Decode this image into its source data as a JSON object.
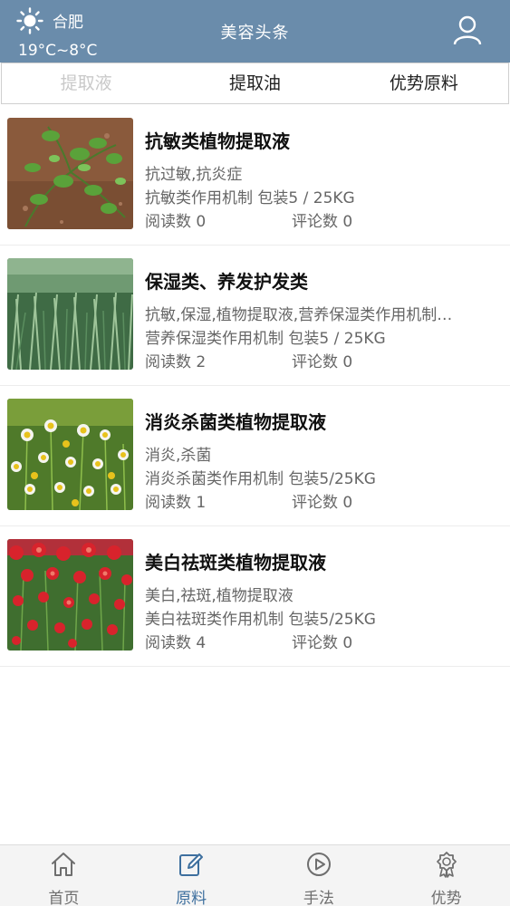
{
  "header": {
    "city": "合肥",
    "temperature": "19°C~8°C",
    "title": "美容头条",
    "weather_icon": "sun-icon",
    "user_icon": "user-icon",
    "bg_color": "#6a8cab"
  },
  "tabs": [
    {
      "label": "提取液",
      "active": true
    },
    {
      "label": "提取油",
      "active": false
    },
    {
      "label": "优势原料",
      "active": false
    }
  ],
  "items": [
    {
      "title": "抗敏类植物提取液",
      "desc": "抗过敏,抗炎症",
      "meta": "抗敏类作用机制  包装5 / 25KG",
      "reads": "阅读数 0",
      "comments": "评论数 0"
    },
    {
      "title": "保湿类、养发护发类",
      "desc": "抗敏,保湿,植物提取液,营养保湿类作用机制…",
      "meta": "营养保湿类作用机制 包装5 / 25KG",
      "reads": "阅读数 2",
      "comments": "评论数 0"
    },
    {
      "title": "消炎杀菌类植物提取液",
      "desc": "消炎,杀菌",
      "meta": "消炎杀菌类作用机制  包装5/25KG",
      "reads": "阅读数 1",
      "comments": "评论数 0"
    },
    {
      "title": "美白祛斑类植物提取液",
      "desc": "美白,祛斑,植物提取液",
      "meta": "美白祛斑类作用机制  包装5/25KG",
      "reads": "阅读数 4",
      "comments": "评论数 0"
    }
  ],
  "bottom_nav": [
    {
      "label": "首页",
      "icon": "home-icon",
      "active": false
    },
    {
      "label": "原料",
      "icon": "edit-icon",
      "active": true
    },
    {
      "label": "手法",
      "icon": "play-icon",
      "active": false
    },
    {
      "label": "优势",
      "icon": "award-icon",
      "active": false
    }
  ],
  "colors": {
    "accent": "#3d6f9e",
    "tab_active": "#c9c9c9",
    "meta_text": "#666666"
  }
}
